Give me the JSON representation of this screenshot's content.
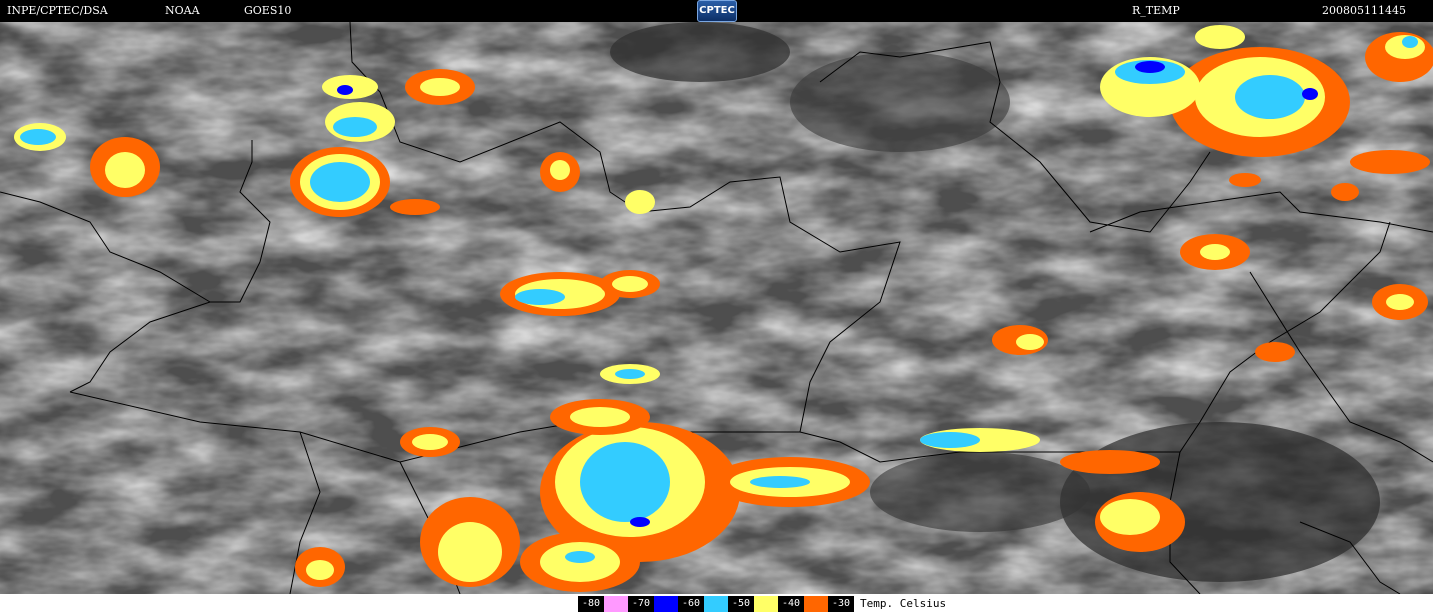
{
  "header": {
    "source": "INPE/CPTEC/DSA",
    "agency": "NOAA",
    "satellite": "GOES10",
    "logo_text": "CPTEC",
    "product": "R_TEMP",
    "timestamp": "200805111445"
  },
  "legend": {
    "unit_label": "Temp. Celsius",
    "items": [
      {
        "label": "-80",
        "color": "#ff99ff"
      },
      {
        "label": "-70",
        "color": "#0000ff"
      },
      {
        "label": "-60",
        "color": "#33ccff"
      },
      {
        "label": "-50",
        "color": "#ffff66"
      },
      {
        "label": "-40",
        "color": "#ff6600"
      },
      {
        "label": "-30",
        "color": "#ff6600"
      }
    ]
  },
  "map": {
    "background_color": "#4b4b4b",
    "border_color": "#000000"
  }
}
